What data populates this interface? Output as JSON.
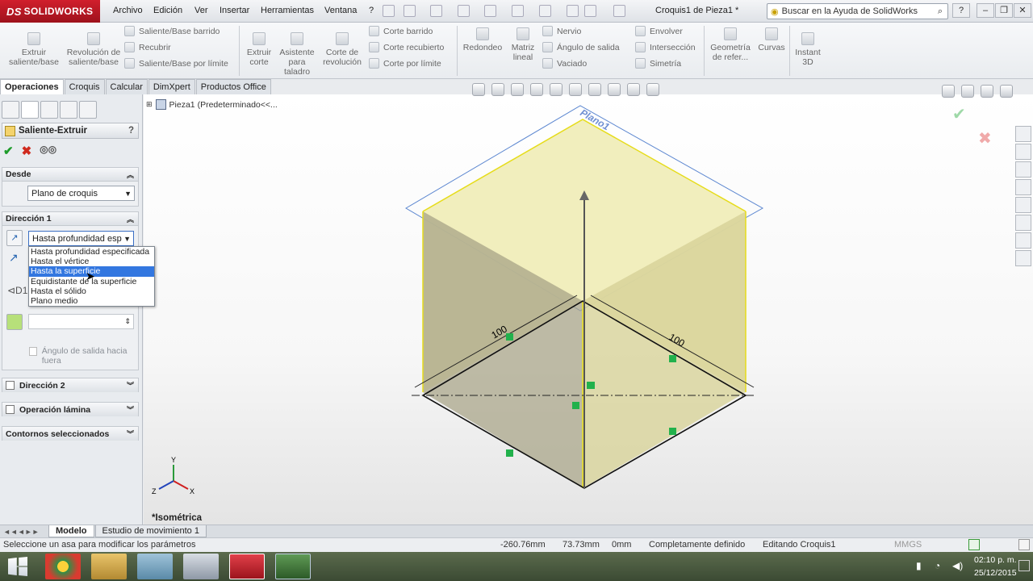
{
  "app": {
    "brand": "SOLIDWORKS",
    "brand_mark": "DS",
    "doc_title": "Croquis1 de Pieza1 *"
  },
  "menu": [
    "Archivo",
    "Edición",
    "Ver",
    "Insertar",
    "Herramientas",
    "Ventana",
    "?"
  ],
  "help_search": {
    "placeholder": "Buscar en la Ayuda de SolidWorks"
  },
  "window_buttons": [
    "?",
    "–",
    "❐",
    "✕"
  ],
  "command_manager": {
    "large": [
      {
        "label": "Extruir saliente/base"
      },
      {
        "label": "Revolución de saliente/base"
      },
      {
        "label": "Extruir corte"
      },
      {
        "label": "Asistente para taladro"
      },
      {
        "label": "Corte de revolución"
      },
      {
        "label": "Redondeo"
      },
      {
        "label": "Matriz lineal"
      },
      {
        "label": "Geometría de refer..."
      },
      {
        "label": "Curvas"
      },
      {
        "label": "Instant 3D"
      }
    ],
    "small_col1": [
      "Saliente/Base barrido",
      "Recubrir",
      "Saliente/Base por límite"
    ],
    "small_col2": [
      "Corte barrido",
      "Corte recubierto",
      "Corte por límite"
    ],
    "small_col3": [
      "Nervio",
      "Ángulo de salida",
      "Vaciado"
    ],
    "small_col4": [
      "Envolver",
      "Intersección",
      "Simetría"
    ]
  },
  "tabs": [
    {
      "label": "Operaciones",
      "active": true
    },
    {
      "label": "Croquis"
    },
    {
      "label": "Calcular"
    },
    {
      "label": "DimXpert"
    },
    {
      "label": "Productos Office"
    }
  ],
  "property_manager": {
    "title": "Saliente-Extruir",
    "help": "?",
    "desde": {
      "header": "Desde",
      "value": "Plano de croquis"
    },
    "direccion1": {
      "header": "Dirección 1",
      "end_condition": "Hasta profundidad esp",
      "options": [
        "Hasta profundidad especificada",
        "Hasta el vértice",
        "Hasta la superficie",
        "Equidistante de la superficie",
        "Hasta el sólido",
        "Plano medio"
      ],
      "selected_index": 2,
      "draft_label": "Ángulo de salida hacia fuera"
    },
    "collapsed_groups": [
      "Dirección 2",
      "Operación lámina",
      "Contornos seleccionados"
    ]
  },
  "tree": {
    "label": "Pieza1  (Predeterminado<<..."
  },
  "viewport": {
    "plane_label": "Plano1",
    "dim_left": "100",
    "dim_right": "100",
    "view_name": "*Isométrica",
    "axis_labels": {
      "x": "X",
      "y": "Y",
      "z": "Z"
    },
    "colors": {
      "fill": "#ede8b0",
      "edge_yellow": "#e6dc1a",
      "plane_blue": "#5b86d0",
      "relation": "#22b14c"
    }
  },
  "bottom_tabs": [
    {
      "label": "Modelo",
      "active": true
    },
    {
      "label": "Estudio de movimiento 1"
    }
  ],
  "status": {
    "message": "Seleccione un asa para modificar los parámetros",
    "x": "-260.76mm",
    "y": "73.73mm",
    "z": "0mm",
    "state": "Completamente definido",
    "mode": "Editando Croquis1",
    "units": "MMGS"
  },
  "clock": {
    "time": "02:10 p. m.",
    "date": "25/12/2015"
  }
}
